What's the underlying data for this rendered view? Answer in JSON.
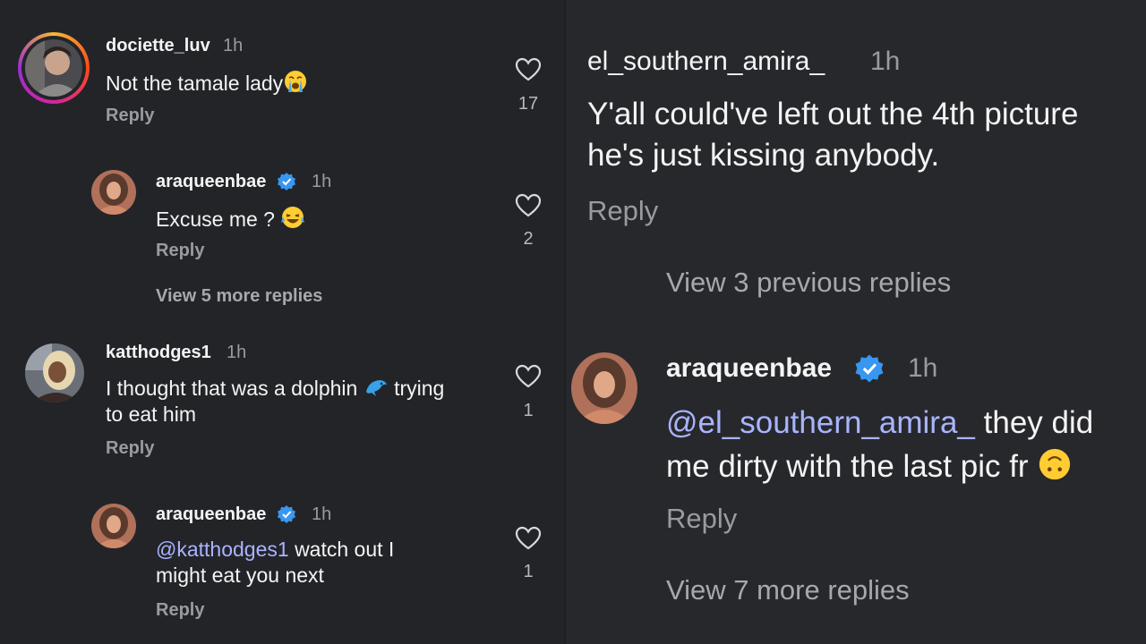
{
  "left": {
    "comments": [
      {
        "username": "dociette_luv",
        "time": "1h",
        "text": "Not the tamale lady",
        "emoji": "crying-emoji",
        "reply": "Reply",
        "likes": "17"
      },
      {
        "username": "araqueenbae",
        "time": "1h",
        "text": "Excuse me ?",
        "emoji": "laughing-emoji",
        "reply": "Reply",
        "likes": "2",
        "verified": true
      },
      {
        "view_more": "View 5 more replies"
      },
      {
        "username": "katthodges1",
        "time": "1h",
        "text_line1_pre": "I thought that was a dolphin",
        "text_line1_post": "trying",
        "text_line2": "to eat him",
        "emoji": "dolphin-emoji",
        "reply": "Reply",
        "likes": "1"
      },
      {
        "username": "araqueenbae",
        "time": "1h",
        "mention": "@katthodges1",
        "text_line1": "watch out I",
        "text_line2": "might eat you next",
        "reply": "Reply",
        "likes": "1",
        "verified": true
      }
    ]
  },
  "right": {
    "comment": {
      "username": "el_southern_amira_",
      "time": "1h",
      "text_line1": "Y'all could've left out the 4th picture",
      "text_line2": "he's just kissing anybody.",
      "reply": "Reply"
    },
    "view_previous": "View 3 previous replies",
    "reply": {
      "username": "araqueenbae",
      "time": "1h",
      "mention": "@el_southern_amira_",
      "text_line1": "they did",
      "text_line2": "me dirty with the last pic fr",
      "emoji": "upside-down-face-emoji",
      "reply": "Reply",
      "verified": true
    },
    "view_more": "View 7 more replies"
  },
  "colors": {
    "background": "#232428",
    "text": "#f4f4f4",
    "muted": "#9a9ba0",
    "mention": "#a9b4ff",
    "verified": "#3897f0"
  }
}
